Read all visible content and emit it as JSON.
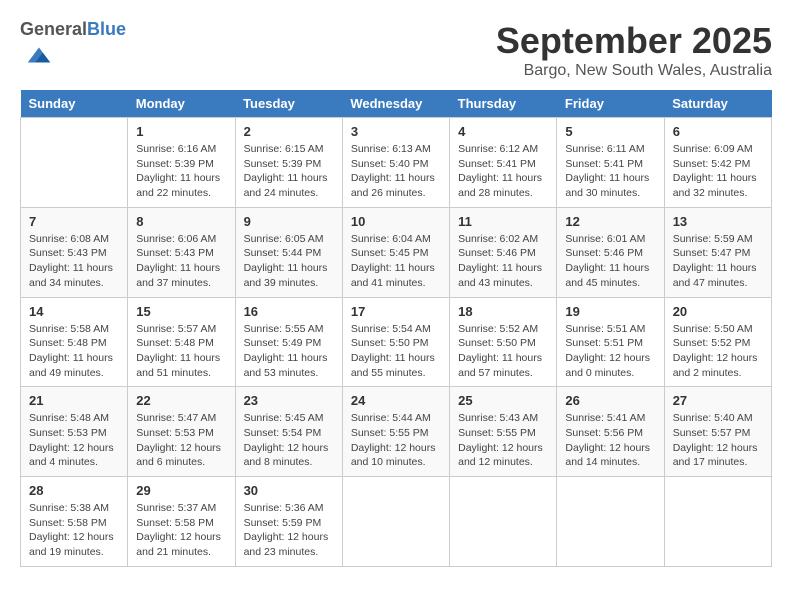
{
  "header": {
    "logo_general": "General",
    "logo_blue": "Blue",
    "month": "September 2025",
    "location": "Bargo, New South Wales, Australia"
  },
  "weekdays": [
    "Sunday",
    "Monday",
    "Tuesday",
    "Wednesday",
    "Thursday",
    "Friday",
    "Saturday"
  ],
  "weeks": [
    [
      {
        "day": "",
        "info": ""
      },
      {
        "day": "1",
        "info": "Sunrise: 6:16 AM\nSunset: 5:39 PM\nDaylight: 11 hours\nand 22 minutes."
      },
      {
        "day": "2",
        "info": "Sunrise: 6:15 AM\nSunset: 5:39 PM\nDaylight: 11 hours\nand 24 minutes."
      },
      {
        "day": "3",
        "info": "Sunrise: 6:13 AM\nSunset: 5:40 PM\nDaylight: 11 hours\nand 26 minutes."
      },
      {
        "day": "4",
        "info": "Sunrise: 6:12 AM\nSunset: 5:41 PM\nDaylight: 11 hours\nand 28 minutes."
      },
      {
        "day": "5",
        "info": "Sunrise: 6:11 AM\nSunset: 5:41 PM\nDaylight: 11 hours\nand 30 minutes."
      },
      {
        "day": "6",
        "info": "Sunrise: 6:09 AM\nSunset: 5:42 PM\nDaylight: 11 hours\nand 32 minutes."
      }
    ],
    [
      {
        "day": "7",
        "info": "Sunrise: 6:08 AM\nSunset: 5:43 PM\nDaylight: 11 hours\nand 34 minutes."
      },
      {
        "day": "8",
        "info": "Sunrise: 6:06 AM\nSunset: 5:43 PM\nDaylight: 11 hours\nand 37 minutes."
      },
      {
        "day": "9",
        "info": "Sunrise: 6:05 AM\nSunset: 5:44 PM\nDaylight: 11 hours\nand 39 minutes."
      },
      {
        "day": "10",
        "info": "Sunrise: 6:04 AM\nSunset: 5:45 PM\nDaylight: 11 hours\nand 41 minutes."
      },
      {
        "day": "11",
        "info": "Sunrise: 6:02 AM\nSunset: 5:46 PM\nDaylight: 11 hours\nand 43 minutes."
      },
      {
        "day": "12",
        "info": "Sunrise: 6:01 AM\nSunset: 5:46 PM\nDaylight: 11 hours\nand 45 minutes."
      },
      {
        "day": "13",
        "info": "Sunrise: 5:59 AM\nSunset: 5:47 PM\nDaylight: 11 hours\nand 47 minutes."
      }
    ],
    [
      {
        "day": "14",
        "info": "Sunrise: 5:58 AM\nSunset: 5:48 PM\nDaylight: 11 hours\nand 49 minutes."
      },
      {
        "day": "15",
        "info": "Sunrise: 5:57 AM\nSunset: 5:48 PM\nDaylight: 11 hours\nand 51 minutes."
      },
      {
        "day": "16",
        "info": "Sunrise: 5:55 AM\nSunset: 5:49 PM\nDaylight: 11 hours\nand 53 minutes."
      },
      {
        "day": "17",
        "info": "Sunrise: 5:54 AM\nSunset: 5:50 PM\nDaylight: 11 hours\nand 55 minutes."
      },
      {
        "day": "18",
        "info": "Sunrise: 5:52 AM\nSunset: 5:50 PM\nDaylight: 11 hours\nand 57 minutes."
      },
      {
        "day": "19",
        "info": "Sunrise: 5:51 AM\nSunset: 5:51 PM\nDaylight: 12 hours\nand 0 minutes."
      },
      {
        "day": "20",
        "info": "Sunrise: 5:50 AM\nSunset: 5:52 PM\nDaylight: 12 hours\nand 2 minutes."
      }
    ],
    [
      {
        "day": "21",
        "info": "Sunrise: 5:48 AM\nSunset: 5:53 PM\nDaylight: 12 hours\nand 4 minutes."
      },
      {
        "day": "22",
        "info": "Sunrise: 5:47 AM\nSunset: 5:53 PM\nDaylight: 12 hours\nand 6 minutes."
      },
      {
        "day": "23",
        "info": "Sunrise: 5:45 AM\nSunset: 5:54 PM\nDaylight: 12 hours\nand 8 minutes."
      },
      {
        "day": "24",
        "info": "Sunrise: 5:44 AM\nSunset: 5:55 PM\nDaylight: 12 hours\nand 10 minutes."
      },
      {
        "day": "25",
        "info": "Sunrise: 5:43 AM\nSunset: 5:55 PM\nDaylight: 12 hours\nand 12 minutes."
      },
      {
        "day": "26",
        "info": "Sunrise: 5:41 AM\nSunset: 5:56 PM\nDaylight: 12 hours\nand 14 minutes."
      },
      {
        "day": "27",
        "info": "Sunrise: 5:40 AM\nSunset: 5:57 PM\nDaylight: 12 hours\nand 17 minutes."
      }
    ],
    [
      {
        "day": "28",
        "info": "Sunrise: 5:38 AM\nSunset: 5:58 PM\nDaylight: 12 hours\nand 19 minutes."
      },
      {
        "day": "29",
        "info": "Sunrise: 5:37 AM\nSunset: 5:58 PM\nDaylight: 12 hours\nand 21 minutes."
      },
      {
        "day": "30",
        "info": "Sunrise: 5:36 AM\nSunset: 5:59 PM\nDaylight: 12 hours\nand 23 minutes."
      },
      {
        "day": "",
        "info": ""
      },
      {
        "day": "",
        "info": ""
      },
      {
        "day": "",
        "info": ""
      },
      {
        "day": "",
        "info": ""
      }
    ]
  ]
}
